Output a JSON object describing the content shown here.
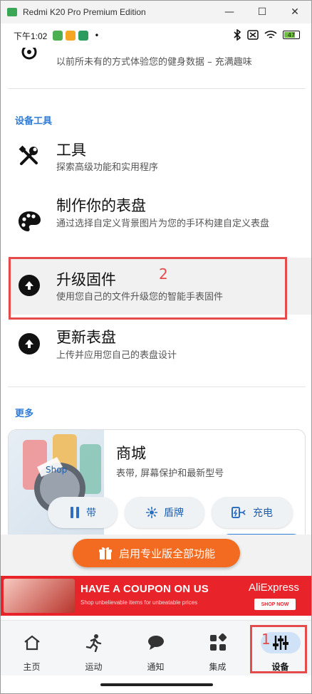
{
  "window": {
    "title": "Redmi K20 Pro Premium Edition",
    "minimize": "—",
    "maximize": "☐",
    "close": "✕"
  },
  "status": {
    "time": "下午1:02",
    "dot": "•"
  },
  "top_item": {
    "subtitle": "以前所未有的方式体验您的健身数据 – 充满趣味"
  },
  "device_tools": {
    "header": "设备工具",
    "items": [
      {
        "title": "工具",
        "subtitle": "探索高级功能和实用程序",
        "icon": "tools-icon"
      },
      {
        "title": "制作你的表盘",
        "subtitle": "通过选择自定义背景图片为您的手环构建自定义表盘",
        "icon": "palette-icon"
      },
      {
        "title": "升级固件",
        "subtitle": "使用您自己的文件升级您的智能手表固件",
        "icon": "upload-arrow-icon"
      },
      {
        "title": "更新表盘",
        "subtitle": "上传并应用您自己的表盘设计",
        "icon": "upload-arrow-icon"
      }
    ]
  },
  "more": {
    "header": "更多",
    "store": {
      "title": "商城",
      "subtitle": "表带, 屏幕保护和最新型号",
      "img_text": "Shop",
      "buttons": [
        {
          "label": "带",
          "icon": "strap-icon"
        },
        {
          "label": "盾牌",
          "icon": "shield-icon"
        },
        {
          "label": "充电",
          "icon": "charger-icon"
        }
      ]
    }
  },
  "promo": {
    "label": "启用专业版全部功能",
    "icon": "gift-icon"
  },
  "ad": {
    "headline": "HAVE A COUPON ON US",
    "subline": "Shop unbelievable items for unbeatable prices",
    "brand": "AliExpress",
    "cta": "SHOP NOW"
  },
  "nav": {
    "items": [
      {
        "label": "主页",
        "icon": "home-icon"
      },
      {
        "label": "运动",
        "icon": "running-icon"
      },
      {
        "label": "通知",
        "icon": "chat-icon"
      },
      {
        "label": "集成",
        "icon": "apps-icon"
      },
      {
        "label": "设备",
        "icon": "sliders-icon",
        "active": true
      }
    ]
  },
  "annotations": {
    "box1": "1",
    "box2": "2"
  },
  "colors": {
    "accent": "#2f7bd6",
    "annotation": "#e54b4b",
    "promo": "#f36b21",
    "ad": "#e8232a"
  }
}
